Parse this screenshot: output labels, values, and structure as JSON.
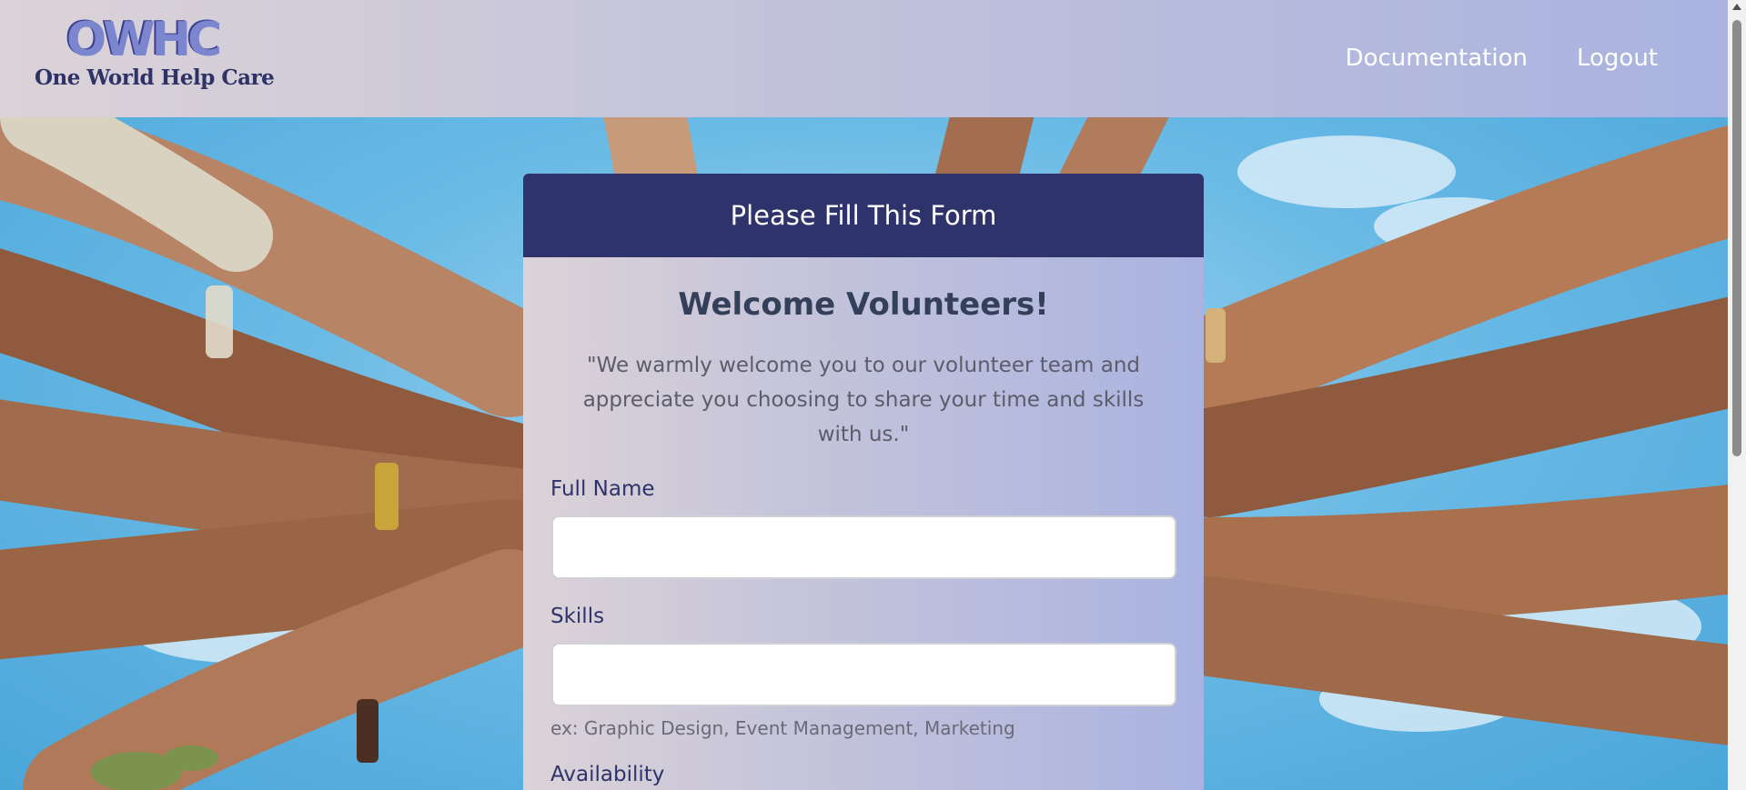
{
  "header": {
    "logo_mark": "OWHC",
    "logo_text": "One World Help Care",
    "nav": {
      "documentation": "Documentation",
      "logout": "Logout"
    }
  },
  "form": {
    "header_title": "Please Fill This Form",
    "title": "Welcome Volunteers!",
    "quote": "\"We warmly welcome you to our volunteer team and appreciate you choosing to share your time and skills with us.\"",
    "fields": {
      "full_name": {
        "label": "Full Name",
        "value": ""
      },
      "skills": {
        "label": "Skills",
        "value": "",
        "help": "ex: Graphic Design, Event Management, Marketing"
      },
      "availability": {
        "label": "Availability"
      }
    }
  },
  "colors": {
    "header_gradient_start": "#dcd3d8",
    "header_gradient_end": "#aab3e0",
    "form_header": "#2e336b",
    "logo_mark": "#7b86cf",
    "logo_text": "#2e3266"
  }
}
